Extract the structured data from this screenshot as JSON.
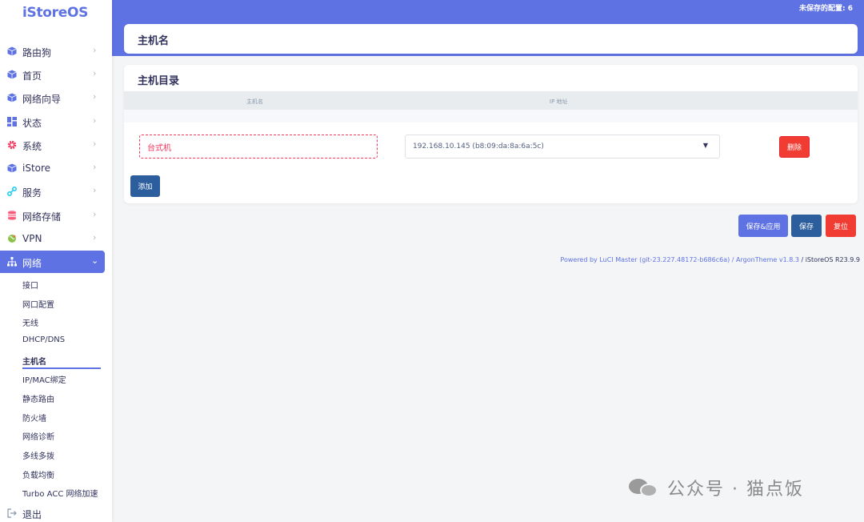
{
  "app": {
    "logo": "iStoreOS"
  },
  "topbar": {
    "unsaved_text": "未保存的配置: 6"
  },
  "sidebar": {
    "items": [
      {
        "label": "路由狗",
        "icon": "cube-icon",
        "color": "#5e72e4"
      },
      {
        "label": "首页",
        "icon": "cube-icon",
        "color": "#5e72e4"
      },
      {
        "label": "网络向导",
        "icon": "cube-icon",
        "color": "#5e72e4"
      },
      {
        "label": "状态",
        "icon": "dashboard-grid-icon",
        "color": "#5e72e4"
      },
      {
        "label": "系统",
        "icon": "gear-icon",
        "color": "#f5365c"
      },
      {
        "label": "iStore",
        "icon": "cube-icon",
        "color": "#5e72e4"
      },
      {
        "label": "服务",
        "icon": "link-icon",
        "color": "#11cdef"
      },
      {
        "label": "网络存储",
        "icon": "database-icon",
        "color": "#f5365c"
      },
      {
        "label": "VPN",
        "icon": "globe-icon",
        "color": "#8bc34a"
      },
      {
        "label": "网络",
        "icon": "sitemap-icon",
        "color": "#ffffff"
      }
    ],
    "subitems": [
      "接口",
      "网口配置",
      "无线",
      "DHCP/DNS",
      "主机名",
      "IP/MAC绑定",
      "静态路由",
      "防火墙",
      "网络诊断",
      "多线多拨",
      "负载均衡",
      "Turbo ACC 网络加速"
    ],
    "logout": "退出"
  },
  "page": {
    "title": "主机名",
    "section_title": "主机目录",
    "columns": [
      "主机名",
      "IP 地址"
    ],
    "row": {
      "hostname": "台式机",
      "ip": "192.168.10.145 (b8:09:da:8a:6a:5c)",
      "delete_label": "删除"
    },
    "add_label": "添加"
  },
  "actions": {
    "save_apply": "保存&应用",
    "save": "保存",
    "reset": "复位"
  },
  "footer": {
    "powered": "Powered by LuCI Master (git-23.227.48172-b686c6a) / ArgonTheme v1.8.3",
    "tail": " / iStoreOS R23.9.9"
  },
  "watermark": {
    "text": "公众号 · 猫点饭"
  },
  "colors": {
    "accent": "#5e72e4",
    "danger": "#f03c32",
    "secondary": "#2c5e9e"
  }
}
